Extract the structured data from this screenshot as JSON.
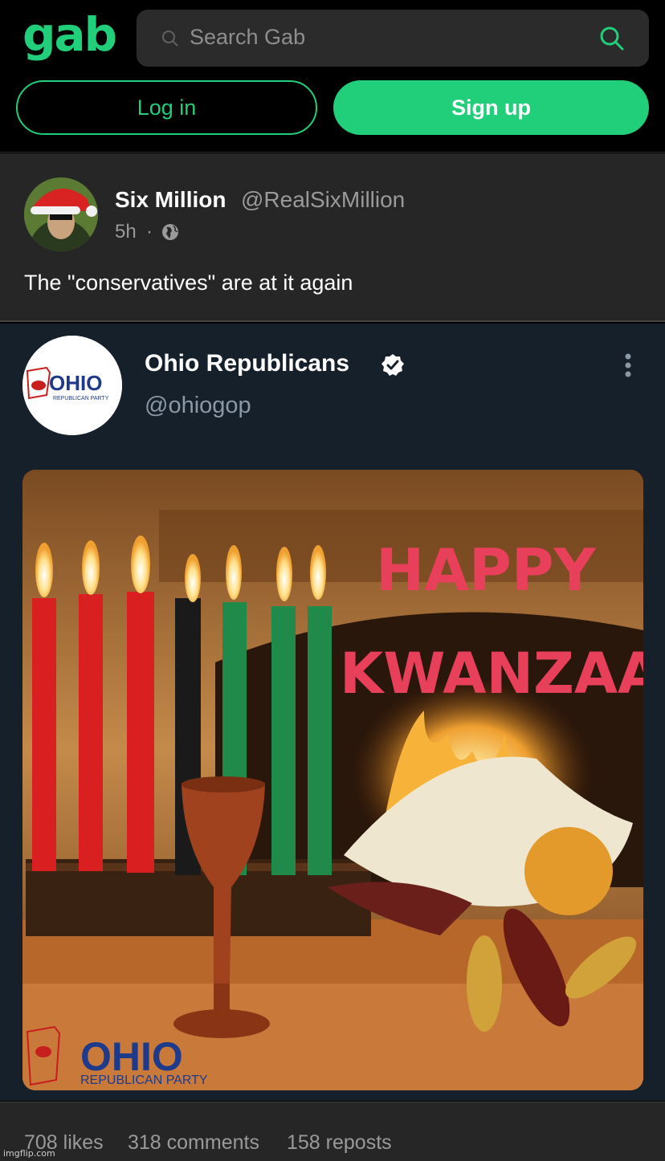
{
  "header": {
    "logo_text": "gab",
    "search_placeholder": "Search Gab",
    "login_label": "Log in",
    "signup_label": "Sign up"
  },
  "post": {
    "author_name": "Six Million",
    "author_handle": "@RealSixMillion",
    "time": "5h",
    "separator": "·",
    "visibility_icon": "globe-icon",
    "text": "The \"conservatives\" are at it again"
  },
  "embed": {
    "name": "Ohio Republicans",
    "handle": "@ohiogop",
    "verified_icon": "verified-badge-icon",
    "more_icon": "vertical-ellipsis-icon",
    "avatar_logo_text": "OHIO",
    "avatar_logo_subtext": "REPUBLICAN PARTY",
    "image": {
      "greeting_line1": "HAPPY",
      "greeting_line2": "KWANZAA",
      "watermark_logo_text": "OHIO",
      "watermark_logo_subtext": "REPUBLICAN PARTY"
    }
  },
  "stats": {
    "likes": "708 likes",
    "comments": "318 comments",
    "reposts": "158 reposts"
  },
  "watermark": "imgflip.com",
  "colors": {
    "brand": "#21cf7a",
    "background": "#000000",
    "post_background": "#262626",
    "embed_background": "#15202b",
    "muted_text": "#9a9a9a"
  }
}
